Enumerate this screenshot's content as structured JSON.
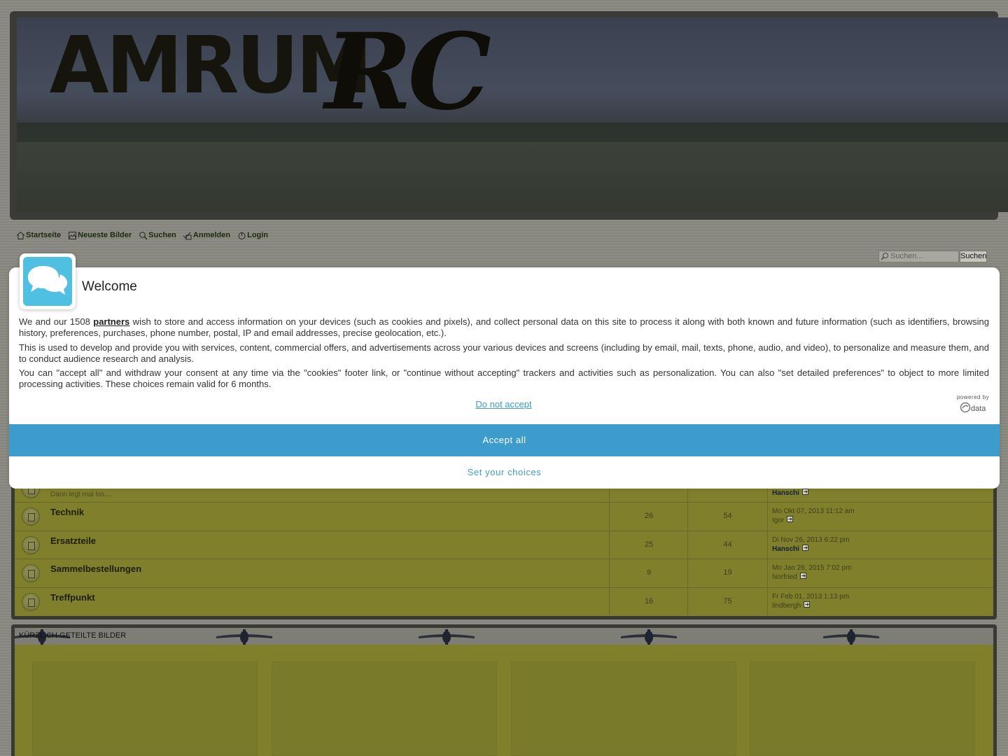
{
  "header": {
    "logo_amrum": "AMRUM",
    "logo_rc": "RC"
  },
  "nav": {
    "items": [
      {
        "label": "Startseite",
        "icon": "home-icon"
      },
      {
        "label": "Neueste Bilder",
        "icon": "image-icon"
      },
      {
        "label": "Suchen",
        "icon": "search-icon"
      },
      {
        "label": "Anmelden",
        "icon": "register-icon"
      },
      {
        "label": "Login",
        "icon": "power-icon"
      }
    ]
  },
  "search": {
    "placeholder": "Suchen...",
    "button_label": "Suchen"
  },
  "forums": [
    {
      "title": "",
      "desc": "Dann legt mal los....",
      "topics": "",
      "posts": "",
      "last_date": "",
      "last_user": "Hanschi",
      "last_user_bold": true
    },
    {
      "title": "Technik",
      "desc": "",
      "topics": "26",
      "posts": "54",
      "last_date": "Mo Okt 07, 2013 11:12 am",
      "last_user": "Igor",
      "last_user_bold": false
    },
    {
      "title": "Ersatzteile",
      "desc": "",
      "topics": "25",
      "posts": "44",
      "last_date": "Di Nov 26, 2013 6:22 pm",
      "last_user": "Hanschi",
      "last_user_bold": true
    },
    {
      "title": "Sammelbestellungen",
      "desc": "",
      "topics": "9",
      "posts": "19",
      "last_date": "Mo Jan 26, 2015 7:02 pm",
      "last_user": "Norfried",
      "last_user_bold": false
    },
    {
      "title": "Treffpunkt",
      "desc": "",
      "topics": "16",
      "posts": "75",
      "last_date": "Fr Feb 01, 2013 1:13 pm",
      "last_user": "lindbergh",
      "last_user_bold": false
    }
  ],
  "gallery": {
    "title": "Kürzlich geteilte Bilder"
  },
  "consent": {
    "title": "Welcome",
    "p1_before": "We and our 1508 ",
    "p1_link": "partners",
    "p1_after": " wish to store and access information on your devices (such as cookies and pixels), and collect personal data on this site to process it along with both known and future information (such as identifiers, browsing history, preferences, purchases, phone number, postal, IP and email addresses, precise geolocation, etc.).",
    "p2": "This is used to develop and provide you with services, content, commercial offers, and advertisements across your various devices and screens (including by email, mail, texts, phone, audio, and video), to personalize and measure them, and to conduct audience research and analysis.",
    "p3": "You can \"accept all\" and withdraw your consent at any time via the \"cookies\" footer link, or \"continue without accepting\" trackers and activities such as personalization. You can also \"set detailed preferences\" to object to more limited processing activities. These choices remain valid for 6 months.",
    "do_not_accept": "Do not accept",
    "powered_by": "powered by",
    "powered_brand": "data",
    "accept_all": "Accept all",
    "set_choices": "Set your choices"
  },
  "colors": {
    "accent": "#3d9ccc",
    "logo_bg": "#4fc0e1",
    "forum_bg": "#7f7f2c"
  }
}
